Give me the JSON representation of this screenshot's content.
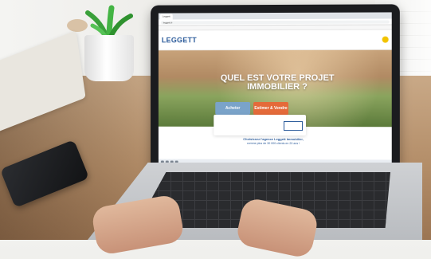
{
  "browser": {
    "tabs": [
      "Leggett"
    ],
    "url": "leggett.fr"
  },
  "site": {
    "logo": "LEGGETT",
    "logo_subtitle": "",
    "nav": [
      "",
      "",
      "",
      "",
      ""
    ],
    "hero": {
      "title": "QUEL EST VOTRE PROJET IMMOBILIER ?",
      "subtitle": ""
    },
    "cta": {
      "buy_label": "Acheter",
      "sell_label": "Estimer & Vendre"
    },
    "search_panel": {
      "field1_label": "",
      "field2_label": "",
      "button_label": ""
    },
    "taglines": [
      "Choisissez l'agence Leggett Immobilier,",
      "comme plus de 30 000 clients en 20 ans !"
    ]
  },
  "colors": {
    "brand_blue": "#2a5a9a",
    "buy_blue": "#7aa3c9",
    "sell_orange": "#e46a3a"
  }
}
